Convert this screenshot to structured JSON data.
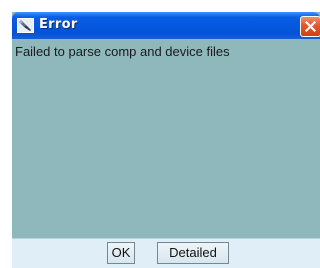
{
  "window": {
    "title": "Error",
    "title_icon": "tool-icon",
    "close_icon": "close-icon"
  },
  "message": {
    "text": "Failed to parse comp and device files"
  },
  "buttons": {
    "ok_label": "OK",
    "detailed_label": "Detailed"
  },
  "colors": {
    "titlebar": "#0558e0",
    "close_button": "#e2572d",
    "message_background": "#8fb8bd",
    "button_panel": "#dfeef7"
  }
}
